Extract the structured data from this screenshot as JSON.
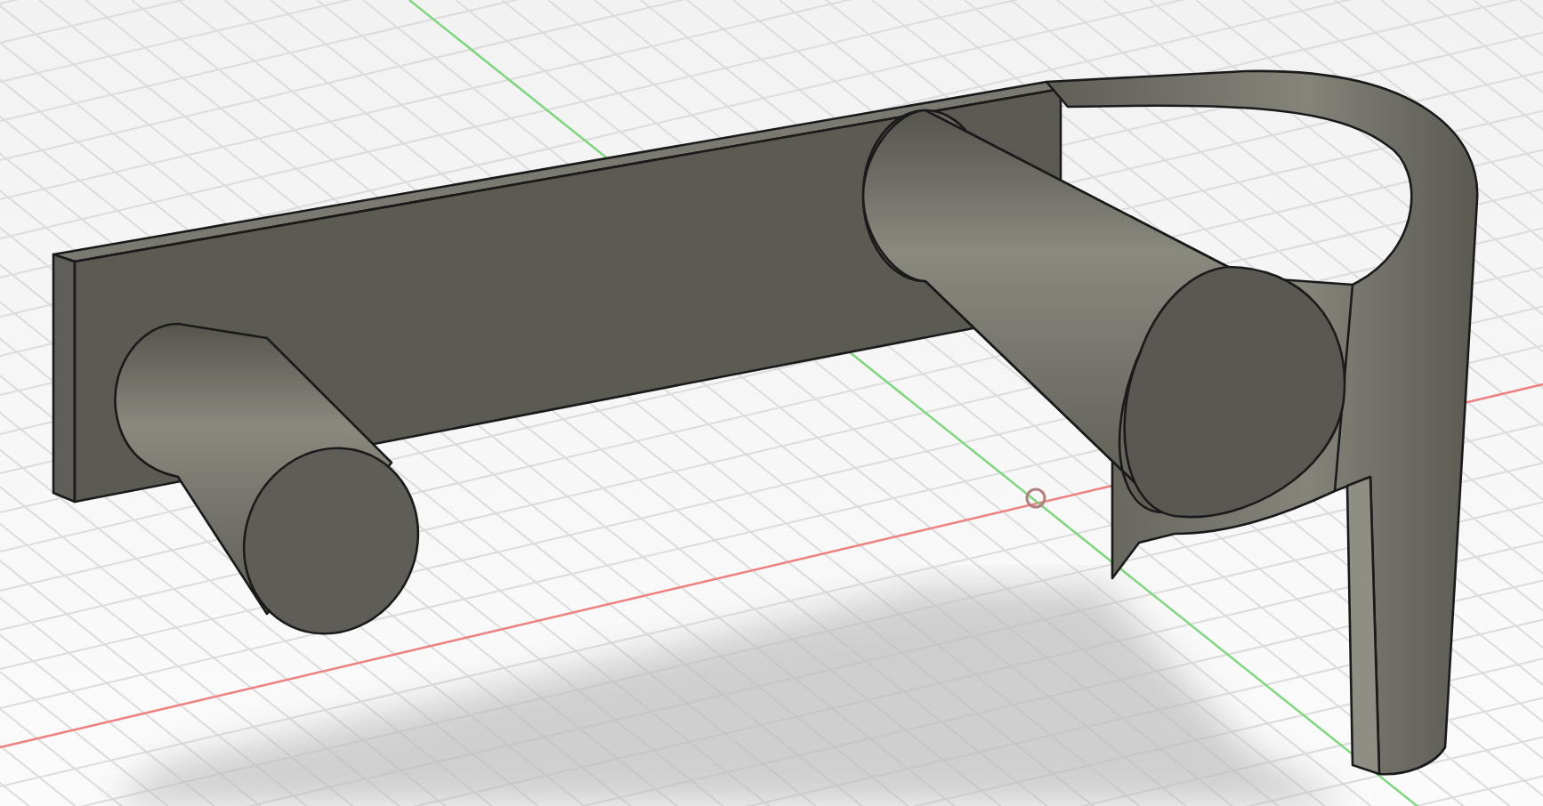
{
  "viewport": {
    "grid": true,
    "shadows": true
  }
}
